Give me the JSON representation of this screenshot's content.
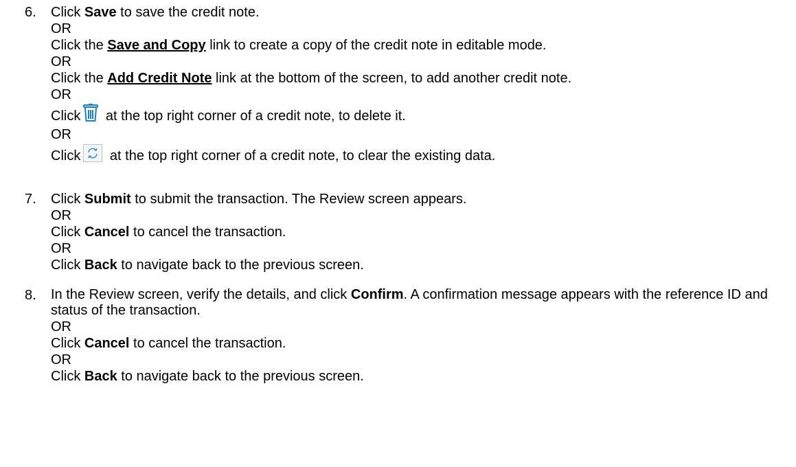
{
  "steps": [
    {
      "number": "6.",
      "s1": {
        "pre": "Click ",
        "bold": "Save",
        "post": " to save the credit note."
      },
      "or1": "OR",
      "s2": {
        "pre": "Click the ",
        "link": "Save and Copy",
        "post": " link to create a copy of the credit note in editable mode."
      },
      "or2": "OR",
      "s3": {
        "pre": "Click the ",
        "link": "Add Credit Note",
        "post": " link at the bottom of the screen, to add another credit note."
      },
      "or3": "OR",
      "s4": {
        "pre": "Click",
        "post": " at the top right corner of a credit note, to delete it.",
        "icon": "trash-icon"
      },
      "or4": "OR",
      "s5": {
        "pre": "Click",
        "post": " at the top right corner of a credit note, to clear the existing data.",
        "icon": "refresh-icon"
      }
    },
    {
      "number": "7.",
      "s1": {
        "pre": "Click ",
        "bold": "Submit",
        "post": " to submit the transaction. The Review screen appears."
      },
      "or1": "OR",
      "s2": {
        "pre": "Click ",
        "bold": "Cancel",
        "post": " to cancel the transaction."
      },
      "or2": "OR",
      "s3": {
        "pre": "Click ",
        "bold": "Back",
        "post": " to navigate back to the previous screen."
      }
    },
    {
      "number": "8.",
      "s1": {
        "pre": "In the Review screen, verify the details, and click ",
        "bold": "Confirm",
        "post": ". A confirmation message appears with the reference ID and status of the transaction."
      },
      "or1": "OR",
      "s2": {
        "pre": "Click ",
        "bold": "Cancel",
        "post": " to cancel the transaction."
      },
      "or2": "OR",
      "s3": {
        "pre": "Click ",
        "bold": "Back",
        "post": " to navigate back to the previous screen."
      }
    }
  ],
  "colors": {
    "text": "#000000",
    "trash_icon": "#1a7fd0",
    "refresh_icon": "#3a8fd8"
  }
}
